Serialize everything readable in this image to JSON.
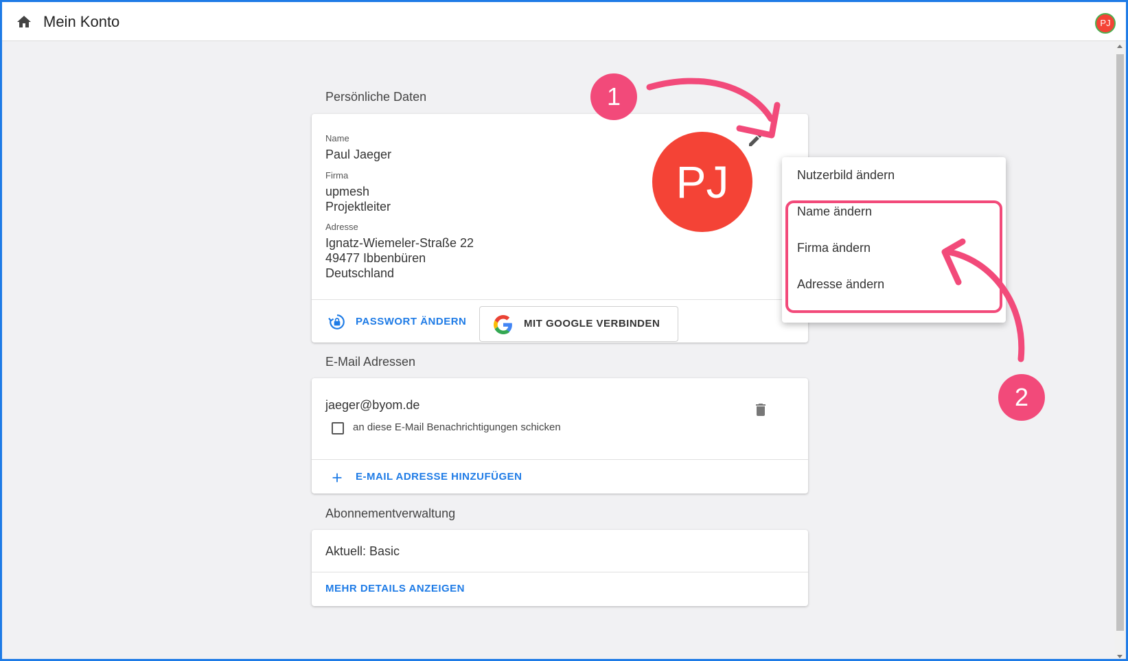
{
  "header": {
    "title": "Mein Konto",
    "avatar_initials": "PJ",
    "home_icon": "home-icon"
  },
  "personal": {
    "section_title": "Persönliche Daten",
    "avatar_initials": "PJ",
    "name_label": "Name",
    "name_value": "Paul Jaeger",
    "company_label": "Firma",
    "company_line1": "upmesh",
    "company_line2": "Projektleiter",
    "address_label": "Adresse",
    "address_line1": "Ignatz-Wiemeler-Straße 22",
    "address_line2": "49477 Ibbenbüren",
    "address_line3": "Deutschland",
    "change_password_label": "PASSWORT ÄNDERN",
    "google_connect_label": "MIT GOOGLE VERBINDEN"
  },
  "menu": {
    "items": [
      {
        "label": "Nutzerbild ändern"
      },
      {
        "label": "Name ändern"
      },
      {
        "label": "Firma ändern"
      },
      {
        "label": "Adresse ändern"
      }
    ]
  },
  "emails": {
    "section_title": "E-Mail Adressen",
    "address": "jaeger@byom.de",
    "notify_label": "an diese E-Mail Benachrichtigungen schicken",
    "notify_checked": false,
    "add_label": "E-MAIL ADRESSE HINZUFÜGEN"
  },
  "subscription": {
    "section_title": "Abonnementverwaltung",
    "current": "Aktuell: Basic",
    "details_label": "MEHR DETAILS ANZEIGEN"
  },
  "annotations": {
    "badge1": "1",
    "badge2": "2"
  },
  "colors": {
    "accent": "#1e7be6",
    "avatar": "#f44336",
    "annotation": "#f24a7a",
    "background": "#f1f1f3"
  }
}
